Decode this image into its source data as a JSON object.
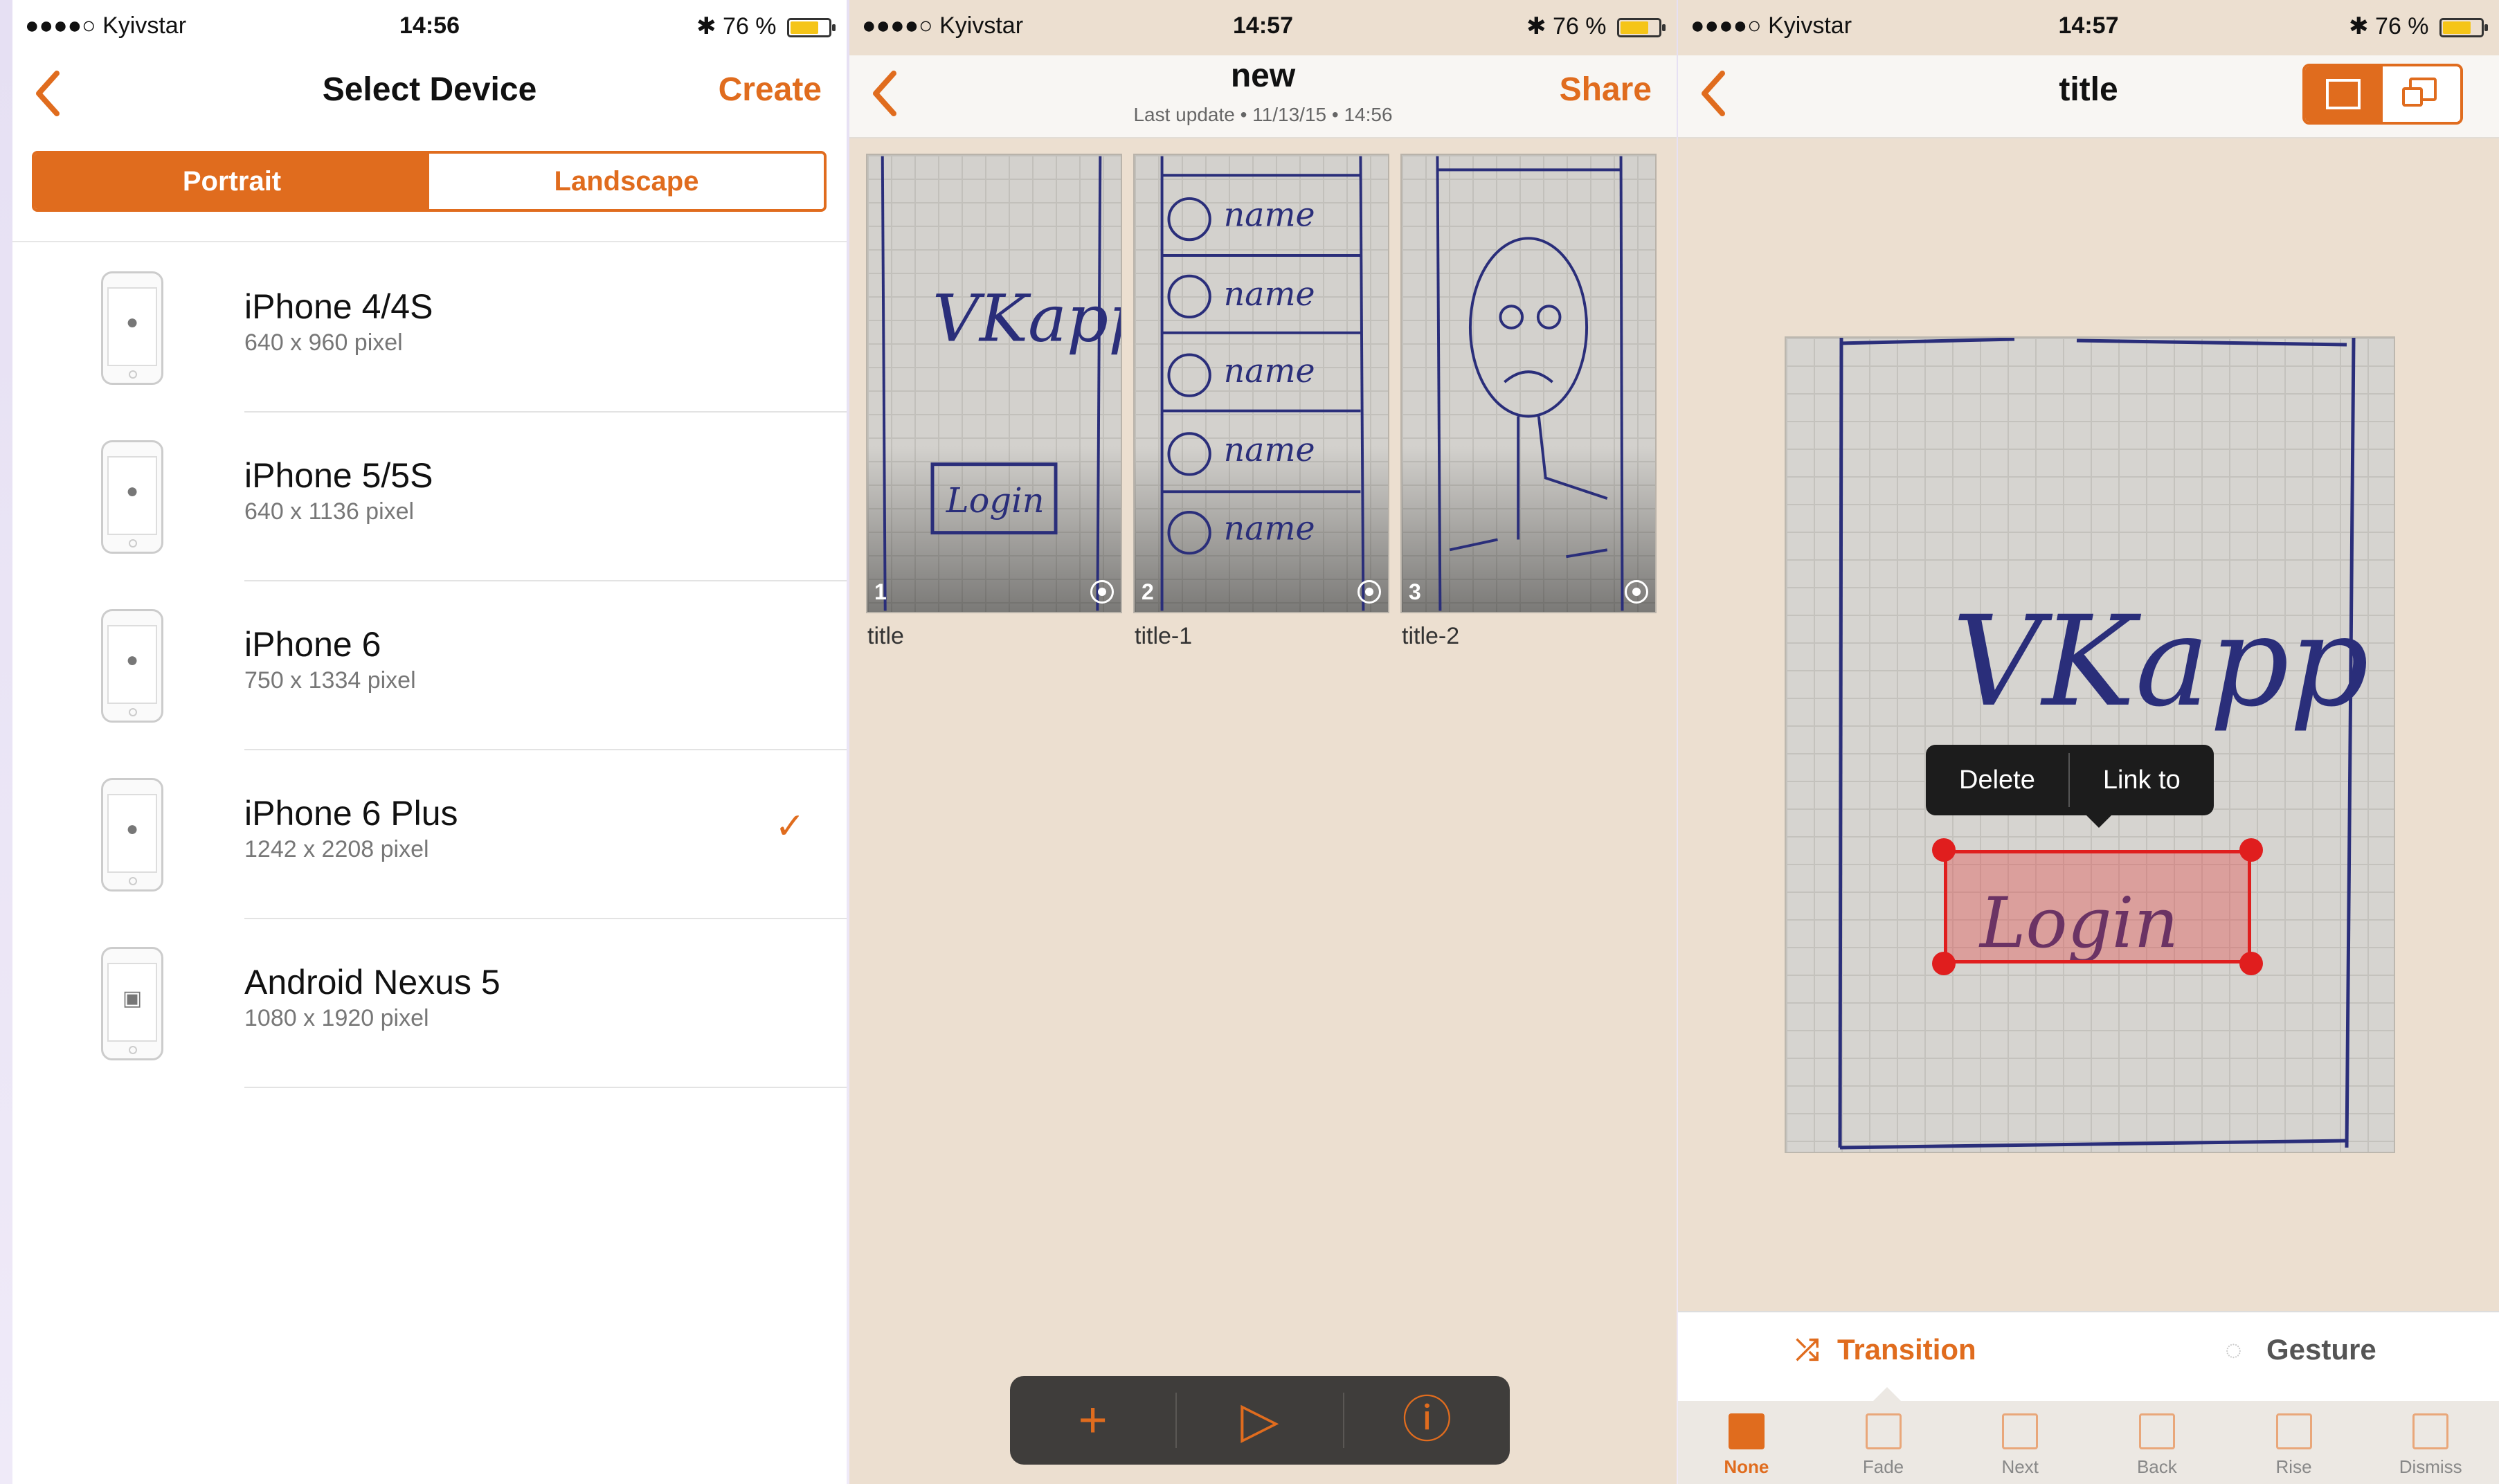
{
  "colors": {
    "accent": "#e06c1e",
    "hotspot": "#e01e1e"
  },
  "screen1": {
    "status": {
      "carrier": "●●●●○ Kyivstar",
      "time": "14:56",
      "battery": "✱ 76 %",
      "battery_level": 0.76
    },
    "nav": {
      "back_icon": "chevron-left-icon",
      "title": "Select Device",
      "action": "Create"
    },
    "orientation": {
      "portrait": "Portrait",
      "landscape": "Landscape",
      "selected": "Portrait"
    },
    "devices": [
      {
        "name": "iPhone 4/4S",
        "resolution": "640 x 960 pixel",
        "icon": "apple-logo-icon",
        "selected": false
      },
      {
        "name": "iPhone 5/5S",
        "resolution": "640 x 1136 pixel",
        "icon": "apple-logo-icon",
        "selected": false
      },
      {
        "name": "iPhone 6",
        "resolution": "750 x 1334 pixel",
        "icon": "apple-logo-icon",
        "selected": false
      },
      {
        "name": "iPhone 6 Plus",
        "resolution": "1242 x 2208 pixel",
        "icon": "apple-logo-icon",
        "selected": true
      },
      {
        "name": "Android Nexus 5",
        "resolution": "1080 x 1920 pixel",
        "icon": "android-logo-icon",
        "selected": false
      }
    ],
    "checkmark": "✓"
  },
  "screen2": {
    "status": {
      "carrier": "●●●●○ Kyivstar",
      "time": "14:57",
      "battery": "✱ 76 %",
      "battery_level": 0.76
    },
    "nav": {
      "title": "new",
      "subtitle": "Last update • 11/13/15 • 14:56",
      "action": "Share"
    },
    "screens": [
      {
        "number": "1",
        "label": "title",
        "sketch_text": [
          "VKapp",
          "Login"
        ]
      },
      {
        "number": "2",
        "label": "title-1",
        "sketch_text": [
          "name",
          "name",
          "name",
          "name",
          "name"
        ]
      },
      {
        "number": "3",
        "label": "title-2",
        "sketch_text": []
      }
    ],
    "toolbar": {
      "add": "+",
      "play": "▷",
      "info": "ⓘ"
    }
  },
  "screen3": {
    "status": {
      "carrier": "●●●●○ Kyivstar",
      "time": "14:57",
      "battery": "✱ 76 %",
      "battery_level": 0.76
    },
    "nav": {
      "title": "title",
      "mode_selected": "frame"
    },
    "canvas_text": {
      "heading": "VKapp",
      "button": "Login"
    },
    "popup": {
      "delete": "Delete",
      "link": "Link to"
    },
    "tabs": {
      "transition": "Transition",
      "gesture": "Gesture",
      "selected": "Transition"
    },
    "transitions": [
      {
        "label": "None",
        "selected": true
      },
      {
        "label": "Fade",
        "selected": false
      },
      {
        "label": "Next",
        "selected": false
      },
      {
        "label": "Back",
        "selected": false
      },
      {
        "label": "Rise",
        "selected": false
      },
      {
        "label": "Dismiss",
        "selected": false
      }
    ]
  }
}
